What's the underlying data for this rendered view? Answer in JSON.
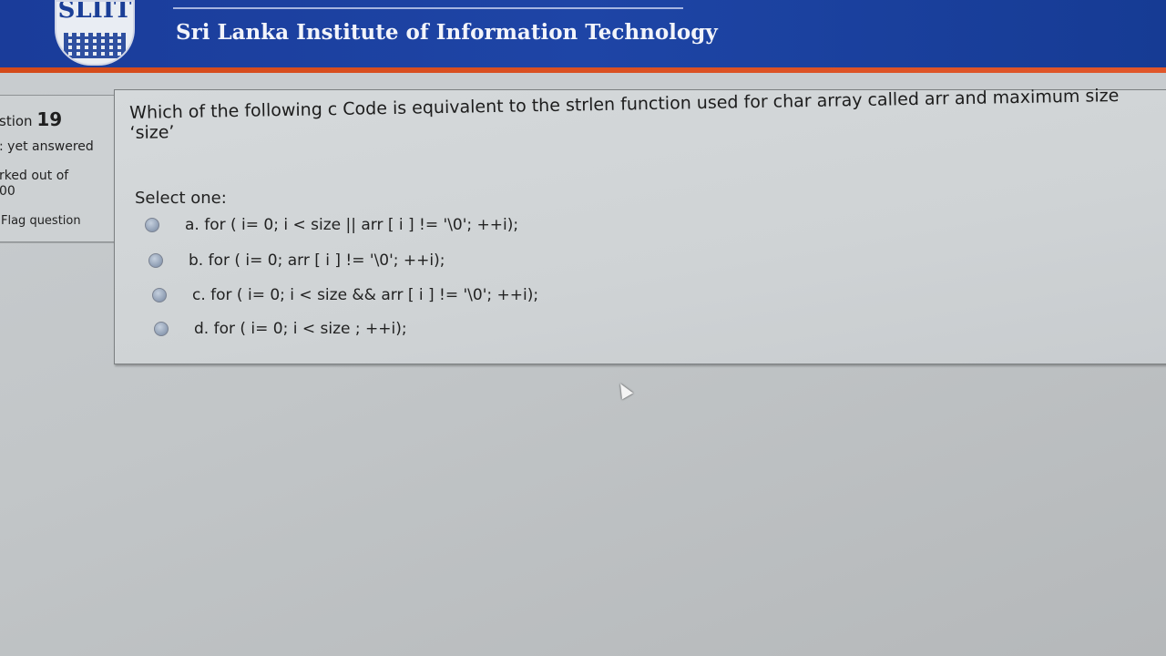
{
  "header": {
    "logo_text": "SLIIT",
    "site_title": "Sri Lanka Institute of Information Technology"
  },
  "info": {
    "question_prefix": "stion",
    "question_number": "19",
    "status": ": yet answered",
    "marked_line1": "rked out of",
    "marked_line2": "00",
    "flag_label": "Flag question"
  },
  "question": {
    "text": "Which of the following c Code is equivalent to the  strlen function used for char array called arr and maximum size ‘size’",
    "select_label": "Select one:",
    "options": [
      "a. for (  i= 0; i < size  ||  arr [ i ] != '\\0'; ++i);",
      "b. for (  i= 0; arr [ i ] != '\\0'; ++i);",
      "c. for (  i= 0; i < size && arr [ i ] != '\\0'; ++i);",
      "d. for (  i= 0; i < size ; ++i);"
    ]
  },
  "colors": {
    "header_blue": "#1e45a6",
    "accent_orange": "#d44a1a"
  }
}
